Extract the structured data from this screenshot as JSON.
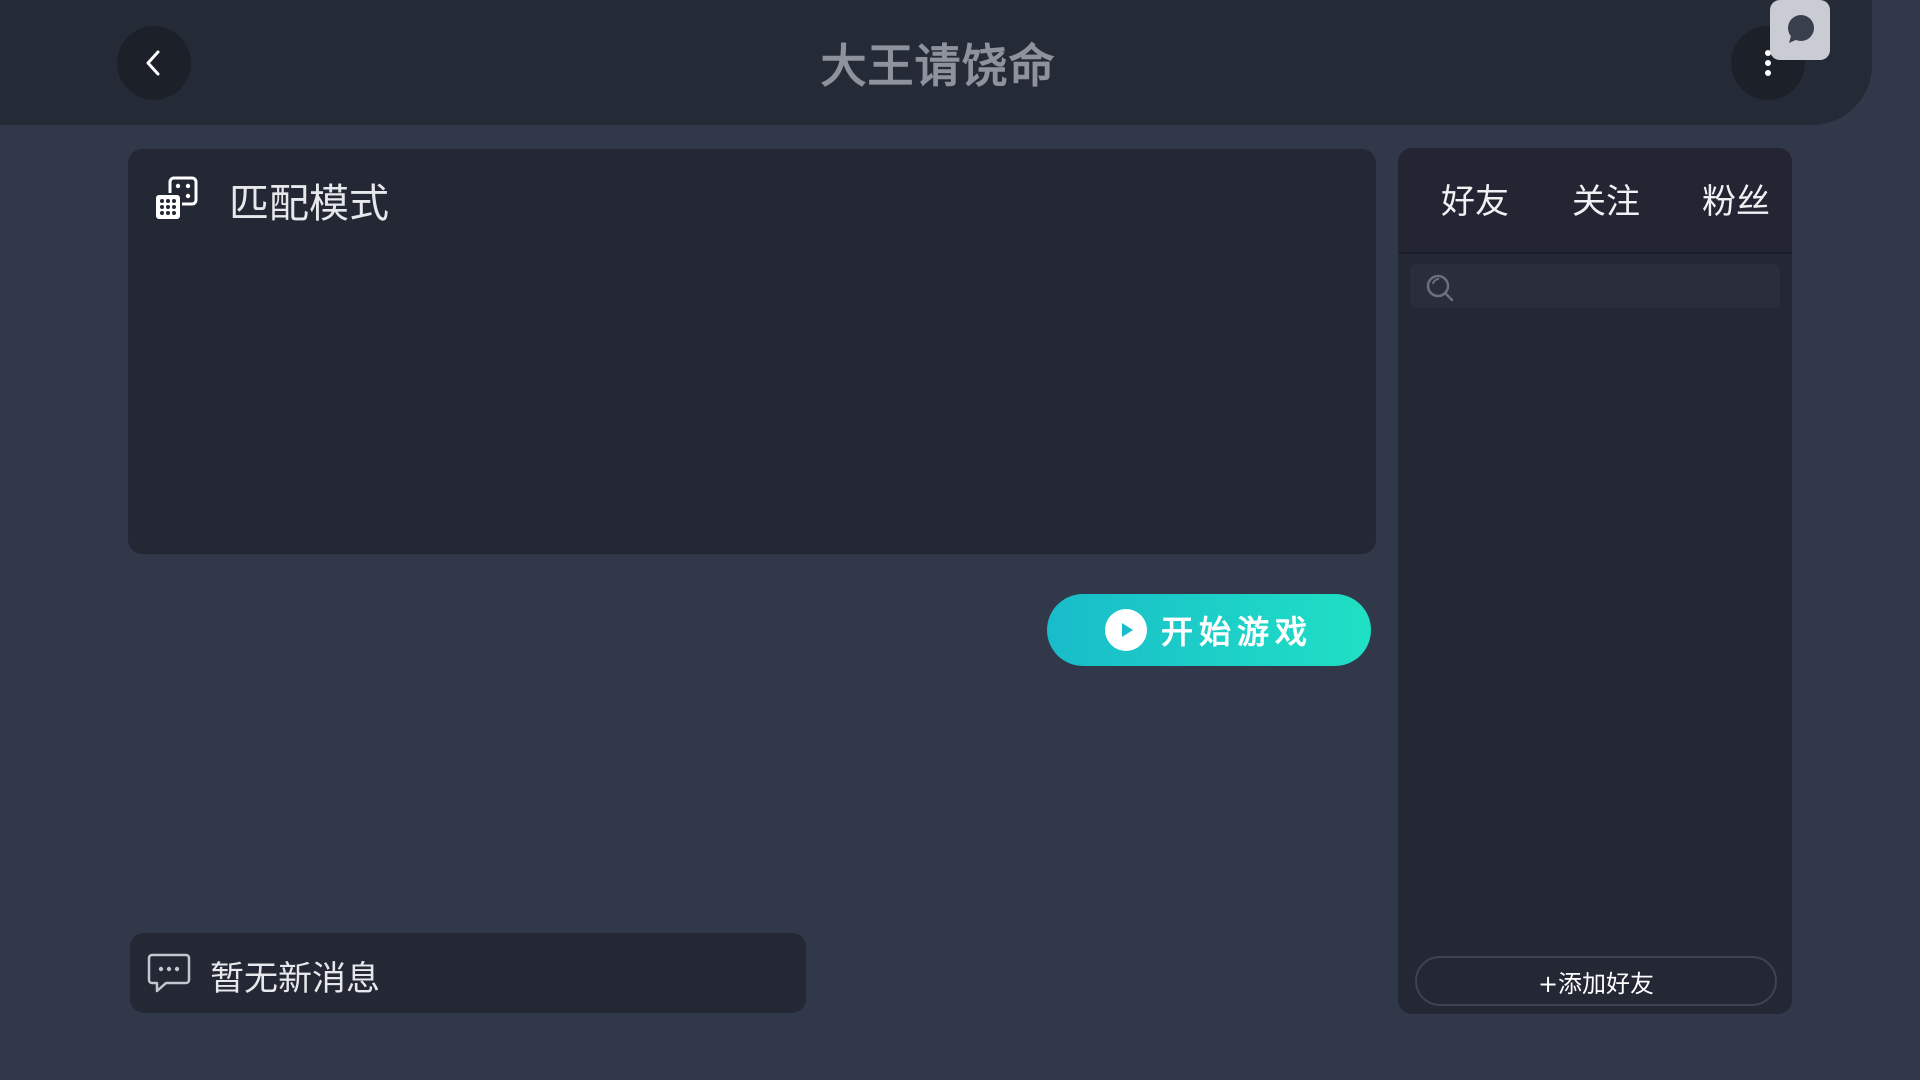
{
  "header": {
    "title": "大王请饶命",
    "back_icon": "chevron-left-icon",
    "more_icon": "more-vertical-icon",
    "chat_icon": "chat-bubble-icon"
  },
  "mode_panel": {
    "icon": "dice-icon",
    "label": "匹配模式"
  },
  "start_button": {
    "icon": "play-circle-icon",
    "label": "开始游戏",
    "gradient": [
      "#19bcca",
      "#1fe0c4"
    ]
  },
  "messages": {
    "icon": "chat-dots-icon",
    "text": "暂无新消息"
  },
  "friends": {
    "tabs": [
      {
        "label": "好友"
      },
      {
        "label": "关注"
      },
      {
        "label": "粉丝"
      }
    ],
    "search": {
      "icon": "search-icon",
      "placeholder": ""
    },
    "add_button": {
      "label": "+添加好友"
    }
  },
  "colors": {
    "background": "#313849",
    "topbar": "#252a37",
    "panel": "#242734",
    "accent": "#1fd6c6"
  }
}
